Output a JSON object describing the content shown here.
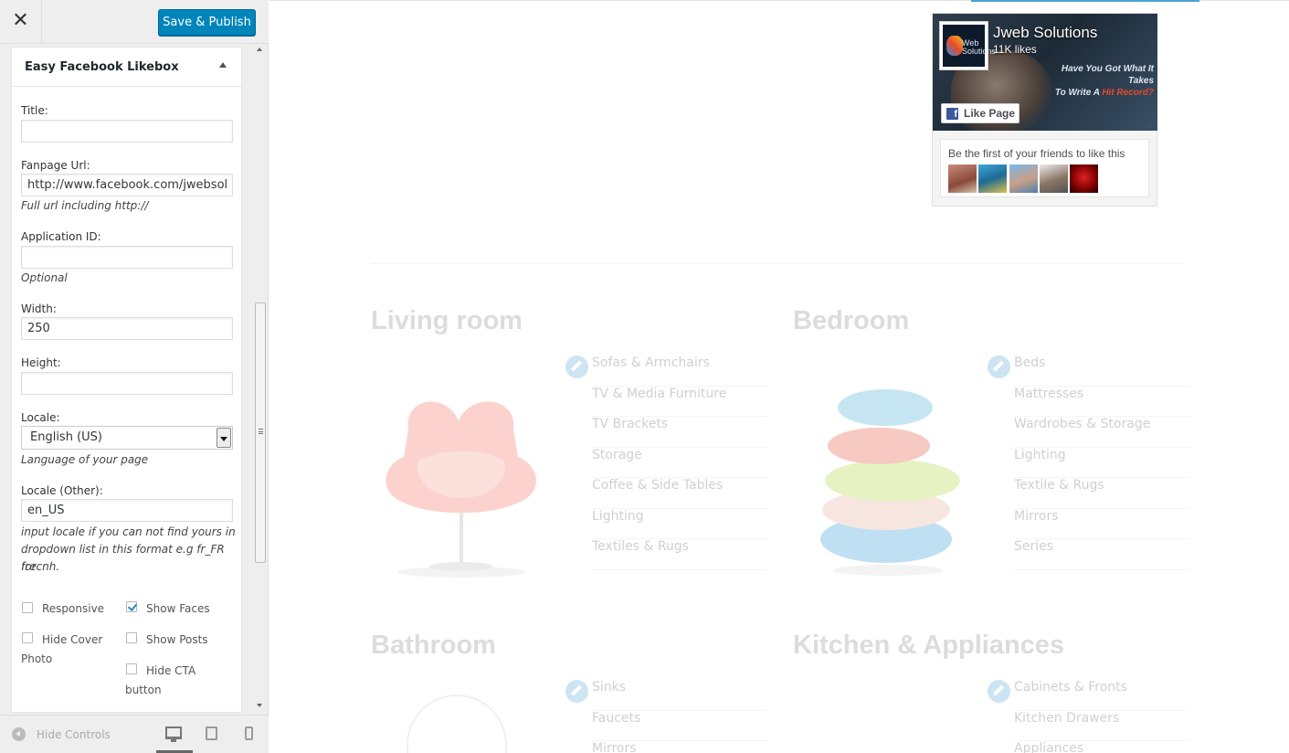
{
  "topbar": {
    "close_glyph": "✕",
    "save_label": "Save & Publish"
  },
  "panel": {
    "title": "Easy Facebook Likebox",
    "fields": {
      "title_label": "Title:",
      "title_value": "",
      "fanpage_label": "Fanpage Url:",
      "fanpage_value": "http://www.facebook.com/jwebsol",
      "fanpage_hint": "Full url including http://",
      "appid_label": "Application ID:",
      "appid_value": "",
      "appid_hint": "Optional",
      "width_label": "Width:",
      "width_value": "250",
      "height_label": "Height:",
      "height_value": "",
      "locale_label": "Locale:",
      "locale_selected": "English (US)",
      "locale_hint": "Language of your page",
      "locale_other_label": "Locale (Other):",
      "locale_other_value": "en_US",
      "locale_other_hint_1": "input locale if you can not find yours in",
      "locale_other_hint_2": "dropdown list in this format e.g fr_FR for",
      "locale_other_hint_3": "frecnh."
    },
    "checkboxes": {
      "responsive": {
        "label": "Responsive",
        "checked": false
      },
      "show_faces": {
        "label": "Show Faces",
        "checked": true
      },
      "hide_cover_1": "Hide Cover",
      "hide_cover_2": "Photo",
      "hide_cover_checked": false,
      "show_posts": {
        "label": "Show Posts",
        "checked": false
      },
      "hide_cta_1": "Hide CTA",
      "hide_cta_2": "button",
      "hide_cta_checked": false
    }
  },
  "footer": {
    "hide_controls_label": "Hide Controls",
    "active_device": "desktop"
  },
  "preview": {
    "facebook_box": {
      "page_name": "Jweb Solutions",
      "likes": "11K likes",
      "logo_text_1": "Web",
      "logo_text_2": "Solutions",
      "tagline_1": "Have You Got What It Takes",
      "tagline_2a": "To Write A ",
      "tagline_2b": "Hit Record?",
      "like_button": "Like Page",
      "like_icon_glyph": "f",
      "friends_text": "Be the first of your friends to like this"
    },
    "categories": [
      {
        "title": "Living room",
        "items": [
          "Sofas & Armchairs",
          "TV & Media Furniture",
          "TV Brackets",
          "Storage",
          "Coffee & Side Tables",
          "Lighting",
          "Textiles & Rugs"
        ]
      },
      {
        "title": "Bedroom",
        "items": [
          "Beds",
          "Mattresses",
          "Wardrobes & Storage",
          "Lighting",
          "Textile & Rugs",
          "Mirrors",
          "Series"
        ]
      },
      {
        "title": "Bathroom",
        "items": [
          "Sinks",
          "Faucets",
          "Mirrors"
        ]
      },
      {
        "title": "Kitchen & Appliances",
        "items": [
          "Cabinets & Fronts",
          "Kitchen Drawers",
          "Appliances"
        ]
      }
    ]
  },
  "colors": {
    "accent": "#0085ba",
    "facebook": "#3b5998",
    "checkbox_check": "#1e8cbe"
  }
}
